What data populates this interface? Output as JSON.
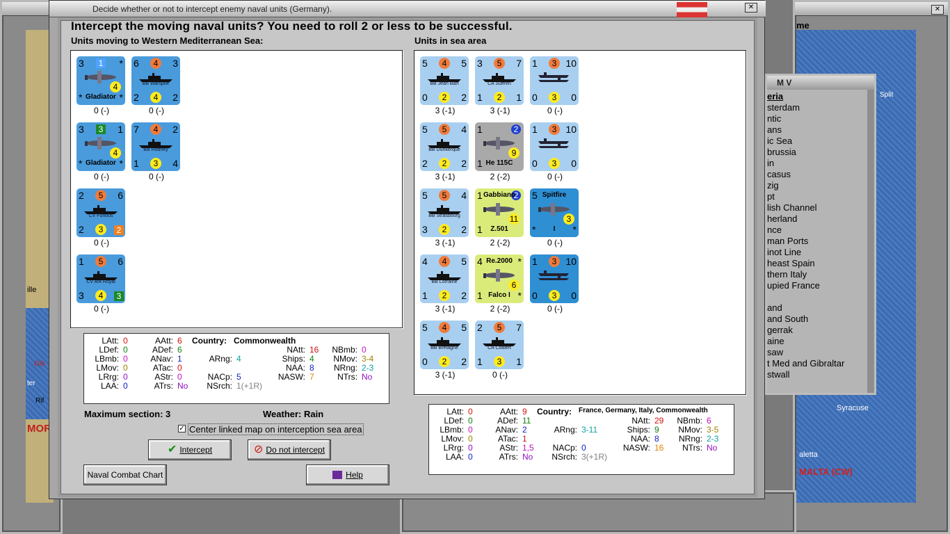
{
  "dialog": {
    "title": "Decide whether or not to intercept enemy naval units (Germany).",
    "heading": "Intercept the moving naval units?  You need to roll 2 or less to be successful.",
    "left_label": "Units moving to Western Mediterranean Sea:",
    "right_label": "Units in sea area",
    "max_section": "Maximum section: 3",
    "weather": "Weather:  Rain",
    "center_checkbox": "Center linked map on interception sea area",
    "intercept_btn": "Intercept",
    "no_intercept_btn": "Do not intercept",
    "naval_chart_btn": "Naval Combat Chart",
    "help_btn": "Help"
  },
  "bg": {
    "right_window_title": "me",
    "list_title": "M V",
    "list_items": [
      "eria",
      "sterdam",
      "ntic",
      "ans",
      "ic Sea",
      "brussia",
      "in",
      "casus",
      "zig",
      "pt",
      "lish Channel",
      "herland",
      "nce",
      "man Ports",
      "inot Line",
      "heast Spain",
      "thern Italy",
      "upied France",
      "",
      "and",
      "and South",
      "gerrak",
      "aine",
      "saw",
      "t Med and Gibraltar",
      "stwall"
    ],
    "map_labels": {
      "gib": "Gib",
      "syracuse": "Syracuse",
      "valetta": "aletta",
      "malta": "MALTA (CW)",
      "split": "Split",
      "ille": "ille",
      "mor": "MOR",
      "rif": "Rif",
      "ter": "ter"
    }
  },
  "moving_units": [
    {
      "kind": "air",
      "bg": "blue",
      "tl": "3",
      "tr": "*",
      "bl": "*",
      "br": "*",
      "badge": "1",
      "badge_color": "#4fa3ff",
      "yc": "4",
      "name": "Gladiator",
      "cap": "0 (-)"
    },
    {
      "kind": "ship",
      "bg": "blue",
      "tl": "6",
      "tr": "3",
      "bl": "2",
      "br": "2",
      "oc": "4",
      "yc": "4",
      "name": "BB Warspite",
      "cap": "0 (-)"
    },
    {
      "kind": "air",
      "bg": "blue",
      "tl": "3",
      "tr": "1",
      "bl": "*",
      "br": "*",
      "badge": "3",
      "badge_color": "#1a8a2a",
      "yc": "4",
      "name": "Gladiator",
      "cap": "0 (-)"
    },
    {
      "kind": "ship",
      "bg": "blue",
      "tl": "7",
      "tr": "2",
      "bl": "1",
      "br": "4",
      "oc": "4",
      "yc": "3",
      "name": "BB Rodney",
      "cap": "0 (-)"
    },
    {
      "kind": "ship",
      "bg": "blue",
      "tl": "2",
      "tr": "6",
      "bl": "2",
      "br": "",
      "oc": "5",
      "yc": "3",
      "sq": "2",
      "sq_color": "#f08020",
      "name": "CV Furious",
      "cap": "0 (-)"
    },
    {
      "kind": "ship",
      "bg": "blue",
      "tl": "1",
      "tr": "6",
      "bl": "3",
      "br": "",
      "oc": "5",
      "yc": "4",
      "sq": "3",
      "sq_color": "#1a8a2a",
      "name": "CV Ark Royal",
      "cap": "0 (-)"
    }
  ],
  "sea_units": [
    {
      "kind": "ship",
      "bg": "lblue",
      "tl": "5",
      "tr": "5",
      "bl": "0",
      "br": "2",
      "oc": "4",
      "yc": "2",
      "name": "BB Jean Bart",
      "cap": "3 (-1)"
    },
    {
      "kind": "ship",
      "bg": "lblue",
      "tl": "3",
      "tr": "7",
      "bl": "1",
      "br": "1",
      "oc": "5",
      "yc": "2",
      "name": "CA Suffren",
      "cap": "3 (-1)"
    },
    {
      "kind": "convoy",
      "bg": "lblue",
      "tl": "1",
      "tr": "10",
      "bl": "0",
      "br": "0",
      "oc": "3",
      "yc": "3",
      "name": "",
      "cap": "0 (-)"
    },
    {
      "kind": "ship",
      "bg": "lblue",
      "tl": "5",
      "tr": "4",
      "bl": "2",
      "br": "2",
      "oc": "5",
      "yc": "2",
      "name": "BB Dunkerque",
      "cap": "3 (-1)"
    },
    {
      "kind": "air",
      "bg": "gray",
      "tl": "1",
      "tr": "",
      "bl": "1",
      "br": "",
      "badge": "2",
      "badge_color": "#1e3fd0",
      "yc": "9",
      "name": "He 115C",
      "cap": "2 (-2)"
    },
    {
      "kind": "convoy",
      "bg": "lblue",
      "tl": "1",
      "tr": "10",
      "bl": "0",
      "br": "0",
      "oc": "3",
      "yc": "3",
      "name": "",
      "cap": "0 (-)"
    },
    {
      "kind": "ship",
      "bg": "lblue",
      "tl": "5",
      "tr": "4",
      "bl": "3",
      "br": "2",
      "oc": "5",
      "yc": "2",
      "name": "BB Strasbourg",
      "cap": "3 (-1)"
    },
    {
      "kind": "air",
      "bg": "green",
      "tl": "1",
      "tr": "",
      "bl": "1",
      "br": "",
      "badge": "2",
      "badge_color": "#1e3fd0",
      "yc": "11",
      "name": "Gabbiano",
      "name2": "Z.501",
      "cap": "2 (-2)"
    },
    {
      "kind": "air",
      "bg": "dkblue",
      "tl": "5",
      "tr": "",
      "bl": "*",
      "br": "*",
      "yc": "3",
      "name": "Spitfire",
      "name2": "I",
      "cap": "0 (-)"
    },
    {
      "kind": "ship",
      "bg": "lblue",
      "tl": "4",
      "tr": "5",
      "bl": "1",
      "br": "2",
      "oc": "4",
      "yc": "2",
      "name": "BB Lorraine",
      "cap": "3 (-1)"
    },
    {
      "kind": "air",
      "bg": "green",
      "tl": "4",
      "tr": "*",
      "bl": "1",
      "br": "*",
      "yc": "6",
      "name": "Re.2000",
      "name2": "Falco I",
      "cap": "2 (-2)"
    },
    {
      "kind": "convoy",
      "bg": "dkblue",
      "tl": "1",
      "tr": "10",
      "bl": "0",
      "br": "0",
      "oc": "3",
      "yc": "3",
      "name": "",
      "cap": "0 (-)"
    },
    {
      "kind": "ship",
      "bg": "lblue",
      "tl": "5",
      "tr": "5",
      "bl": "0",
      "br": "2",
      "oc": "4",
      "yc": "2",
      "name": "BB Bretagne",
      "cap": "3 (-1)"
    },
    {
      "kind": "ship",
      "bg": "lblue",
      "tl": "2",
      "tr": "7",
      "bl": "1",
      "br": "1",
      "oc": "5",
      "yc": "3",
      "name": "CA Colbert",
      "cap": "0 (-)"
    }
  ],
  "stats_left": {
    "country_label": "Country:",
    "country": "Commonwealth",
    "LAtt": "0",
    "LDef": "0",
    "LBmb": "0",
    "LMov": "0",
    "LRrg": "0",
    "LAA": "0",
    "AAtt": "6",
    "ADef": "6",
    "ANav": "1",
    "ATac": "0",
    "AStr": "0",
    "ATrs": "No",
    "ARng": "4",
    "NACp": "5",
    "NSrch": "1(+1R)",
    "NAtt": "16",
    "Ships": "4",
    "NAA": "8",
    "NASW": "7",
    "NBmb": "0",
    "NMov": "3-4",
    "NRng": "2-3",
    "NTrs": "No"
  },
  "stats_right": {
    "country_label": "Country:",
    "country": "France, Germany, Italy, Commonwealth",
    "LAtt": "0",
    "LDef": "0",
    "LBmb": "0",
    "LMov": "0",
    "LRrg": "0",
    "LAA": "0",
    "AAtt": "9",
    "ADef": "11",
    "ANav": "2",
    "ATac": "1",
    "AStr": "1,5",
    "ATrs": "No",
    "ARng": "3-11",
    "NACp": "0",
    "NSrch": "3(+1R)",
    "NAtt": "29",
    "Ships": "9",
    "NAA": "8",
    "NASW": "16",
    "NBmb": "6",
    "NMov": "3-5",
    "NRng": "2-3",
    "NTrs": "No"
  },
  "stat_labels": {
    "LAtt": "LAtt:",
    "LDef": "LDef:",
    "LBmb": "LBmb:",
    "LMov": "LMov:",
    "LRrg": "LRrg:",
    "LAA": "LAA:",
    "AAtt": "AAtt:",
    "ADef": "ADef:",
    "ANav": "ANav:",
    "ATac": "ATac:",
    "AStr": "AStr:",
    "ATrs": "ATrs:",
    "ARng": "ARng:",
    "NACp": "NACp:",
    "NSrch": "NSrch:",
    "NAtt": "NAtt:",
    "Ships": "Ships:",
    "NAA": "NAA:",
    "NASW": "NASW:",
    "NBmb": "NBmb:",
    "NMov": "NMov:",
    "NRng": "NRng:",
    "NTrs": "NTrs:"
  },
  "icons": {
    "check": "✔",
    "no": "⊘",
    "help": "?",
    "close": "✕"
  }
}
